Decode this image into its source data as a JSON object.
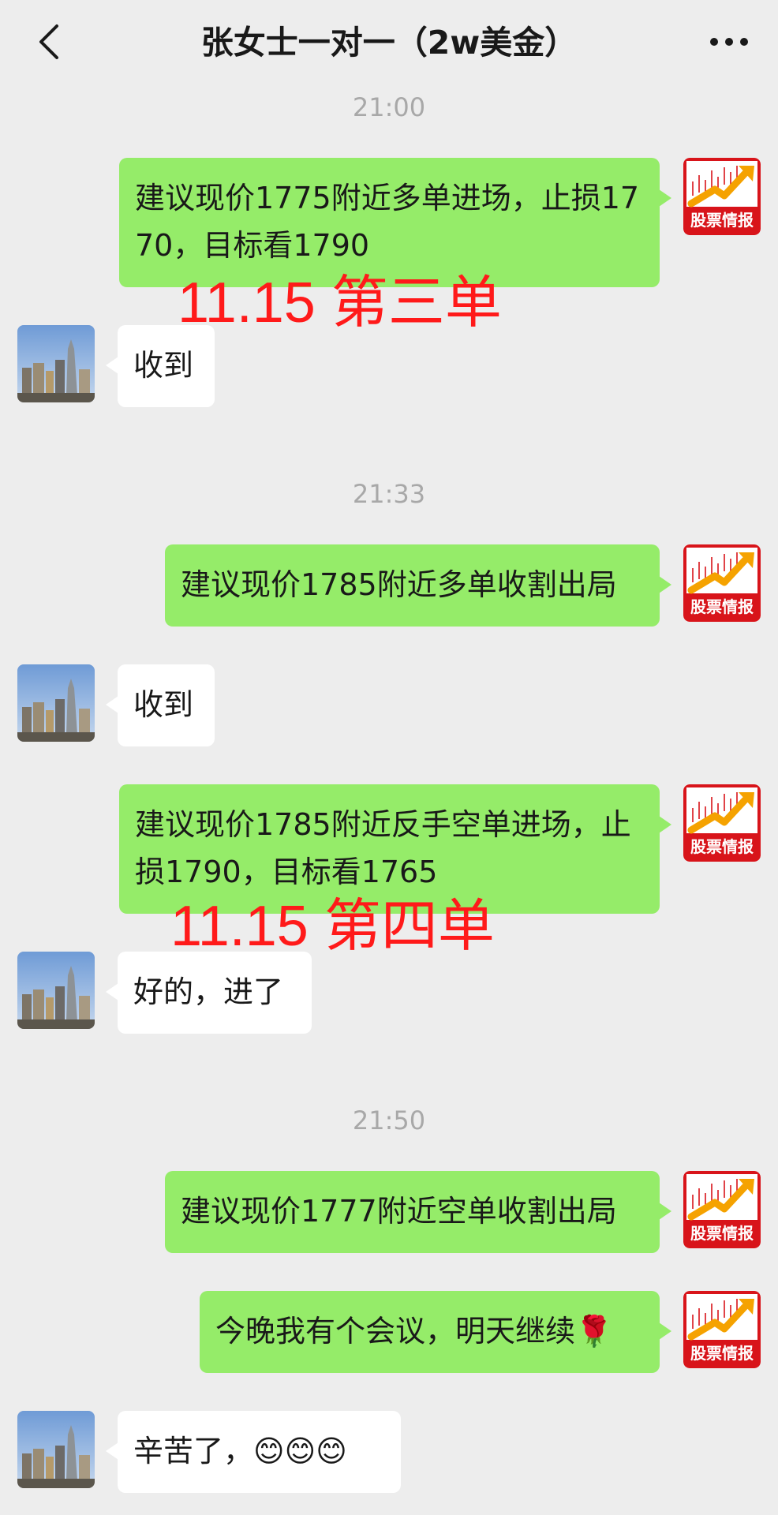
{
  "header": {
    "title": "张女士一对一（2w美金）",
    "back_icon": "chevron-left-icon",
    "more_icon": "more-dots-icon"
  },
  "account_logo_text": "股票情报",
  "messages": {
    "t1": "21:00",
    "m1": "建议现价1775附近多单进场，止损1770，目标看1790",
    "annot1": "11.15  第三单",
    "r1": "收到",
    "t2": "21:33",
    "m2": "建议现价1785附近多单收割出局",
    "r2": "收到",
    "m3": "建议现价1785附近反手空单进场，止损1790，目标看1765",
    "annot2": "11.15  第四单",
    "r3": "好的，进了",
    "t3": "21:50",
    "m4": "建议现价1777附近空单收割出局",
    "m5": "今晚我有个会议，明天继续",
    "m5_emoji": "🌹",
    "r4": "辛苦了，",
    "r4_emoji": "😊😊😊"
  },
  "colors": {
    "background": "#ededed",
    "sent_bubble": "#95ec69",
    "received_bubble": "#ffffff",
    "annotation": "#ff1a1a",
    "logo_red": "#d8141a"
  }
}
